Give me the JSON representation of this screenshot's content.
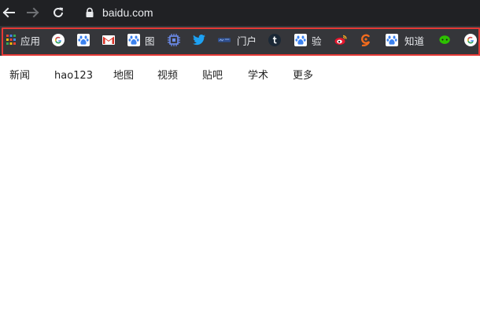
{
  "address_bar": {
    "url": "baidu.com"
  },
  "bookmarks": [
    {
      "icon": "apps-grid-icon",
      "label": "应用"
    },
    {
      "icon": "google-icon",
      "label": ""
    },
    {
      "icon": "baidu-paw-icon",
      "label": ""
    },
    {
      "icon": "gmail-icon",
      "label": ""
    },
    {
      "icon": "baidu-paw-icon",
      "label": "图"
    },
    {
      "icon": "chip-icon",
      "label": ""
    },
    {
      "icon": "twitter-bird-icon",
      "label": ""
    },
    {
      "icon": "portal-logo-icon",
      "label": "门户"
    },
    {
      "icon": "tumblr-icon",
      "label": ""
    },
    {
      "icon": "baidu-paw-icon",
      "label": "验"
    },
    {
      "icon": "weibo-icon",
      "label": ""
    },
    {
      "icon": "orange-swirl-icon",
      "label": ""
    },
    {
      "icon": "baidu-paw-icon",
      "label": "知道"
    },
    {
      "icon": "wechat-icon",
      "label": ""
    },
    {
      "icon": "google-icon",
      "label": ""
    }
  ],
  "page_nav": [
    "新闻",
    "hao123",
    "地图",
    "视频",
    "贴吧",
    "学术",
    "更多"
  ],
  "colors": {
    "toolbar": "#202124",
    "bookmarks_bar": "#35363a",
    "highlight_border": "#e53935",
    "baidu_blue": "#3b82f0",
    "twitter_blue": "#1da1f2"
  }
}
